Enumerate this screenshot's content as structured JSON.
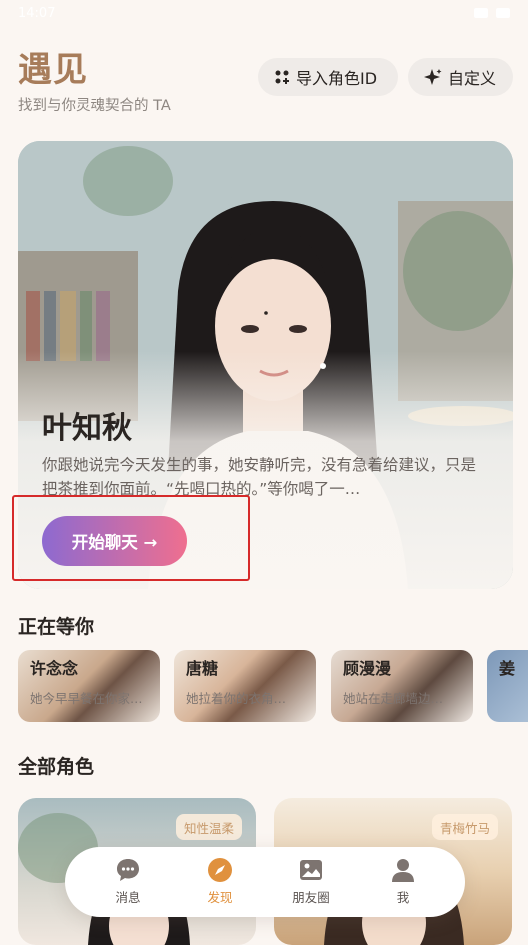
{
  "status": {
    "time": "14:07"
  },
  "header": {
    "title": "遇见",
    "subtitle": "找到与你灵魂契合的 TA",
    "import_label": "导入角色ID",
    "custom_label": "自定义"
  },
  "hero": {
    "name": "叶知秋",
    "description": "你跟她说完今天发生的事，她安静听完，没有急着给建议，只是把茶推到你面前。“先喝口热的。”等你喝了一…",
    "button_label": "开始聊天 →"
  },
  "waiting": {
    "title": "正在等你",
    "items": [
      {
        "name": "许念念",
        "message": "她今早早餐在你家…"
      },
      {
        "name": "唐糖",
        "message": "她拉着你的衣角…"
      },
      {
        "name": "顾漫漫",
        "message": "她站在走廊墙边…"
      },
      {
        "name": "姜",
        "message": ""
      }
    ]
  },
  "all_roles": {
    "title": "全部角色",
    "items": [
      {
        "tag": "知性温柔"
      },
      {
        "tag": "青梅竹马"
      }
    ]
  },
  "nav": {
    "items": [
      {
        "label": "消息",
        "icon": "chat-icon"
      },
      {
        "label": "发现",
        "icon": "compass-icon"
      },
      {
        "label": "朋友圈",
        "icon": "image-icon"
      },
      {
        "label": "我",
        "icon": "person-icon"
      }
    ],
    "active": "发现"
  },
  "colors": {
    "accent": "#e0913e",
    "title": "#a77c5a",
    "highlight": "#d62a2a",
    "button_gradient_start": "#8d6ad0",
    "button_gradient_end": "#ef6f8f"
  }
}
